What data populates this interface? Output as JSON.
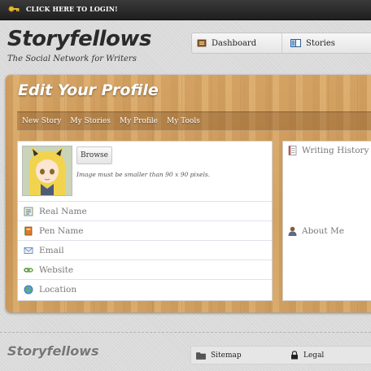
{
  "topbar": {
    "login_label": "CLICK HERE TO LOGIN!"
  },
  "brand": {
    "name": "Storyfellows",
    "tagline": "The Social Network for Writers"
  },
  "topnav": {
    "dashboard": "Dashboard",
    "stories": "Stories"
  },
  "profile": {
    "title": "Edit Your Profile",
    "tabs": [
      "New Story",
      "My Stories",
      "My Profile",
      "My Tools"
    ],
    "browse_label": "Browse",
    "image_hint": "Image must be smaller than 90 x 90 pixels.",
    "fields": [
      "Real Name",
      "Pen Name",
      "Email",
      "Website",
      "Location"
    ],
    "right_sections": [
      "Writing History",
      "About Me"
    ]
  },
  "footer": {
    "logo": "Storyfellows",
    "sitemap": "Sitemap",
    "legal": "Legal"
  },
  "icons": {
    "login": "key-icon",
    "dashboard": "dashboard-icon",
    "stories": "book-icon",
    "real_name": "id-card-icon",
    "pen_name": "notebook-icon",
    "email": "envelope-icon",
    "website": "link-icon",
    "location": "globe-icon",
    "writing_history": "document-icon",
    "about_me": "person-icon",
    "sitemap": "folder-icon",
    "legal": "lock-icon"
  },
  "colors": {
    "accent": "#d4a363",
    "topbar": "#2a2a2a"
  }
}
